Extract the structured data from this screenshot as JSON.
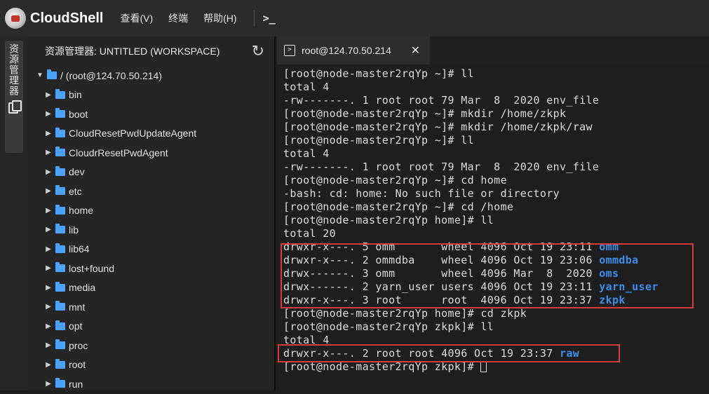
{
  "app": {
    "brand": "CloudShell"
  },
  "menu": [
    "查看(V)",
    "终端",
    "帮助(H)"
  ],
  "toolbar": {
    "terminal_icon": ">_"
  },
  "activity": {
    "explorer_label": "资源管理器"
  },
  "explorer": {
    "title": "资源管理器: UNTITLED (WORKSPACE)",
    "root": "/ (root@124.70.50.214)",
    "items": [
      "bin",
      "boot",
      "CloudResetPwdUpdateAgent",
      "CloudrResetPwdAgent",
      "dev",
      "etc",
      "home",
      "lib",
      "lib64",
      "lost+found",
      "media",
      "mnt",
      "opt",
      "proc",
      "root",
      "run"
    ]
  },
  "tab": {
    "label": "root@124.70.50.214"
  },
  "colors": {
    "accent": "#3b8eea",
    "highlight": "#d83b3b",
    "folder": "#4aa3ff"
  },
  "terminal_lines": [
    [
      {
        "t": "[root@node-master2rqYp ~]# ll"
      }
    ],
    [
      {
        "t": "total 4"
      }
    ],
    [
      {
        "t": "-rw-------. 1 root root 79 Mar  8  2020 env_file"
      }
    ],
    [
      {
        "t": "[root@node-master2rqYp ~]# mkdir /home/zkpk"
      }
    ],
    [
      {
        "t": "[root@node-master2rqYp ~]# mkdir /home/zkpk/raw"
      }
    ],
    [
      {
        "t": "[root@node-master2rqYp ~]# ll"
      }
    ],
    [
      {
        "t": "total 4"
      }
    ],
    [
      {
        "t": "-rw-------. 1 root root 79 Mar  8  2020 env_file"
      }
    ],
    [
      {
        "t": "[root@node-master2rqYp ~]# cd home"
      }
    ],
    [
      {
        "t": "-bash: cd: home: No such file or directory"
      }
    ],
    [
      {
        "t": "[root@node-master2rqYp ~]# cd /home"
      }
    ],
    [
      {
        "t": "[root@node-master2rqYp home]# ll"
      }
    ],
    [
      {
        "t": "total 20"
      }
    ],
    [
      {
        "t": "drwxr-x---. 5 omm       wheel 4096 Oct 19 23:11 "
      },
      {
        "t": "omm",
        "dir": true
      }
    ],
    [
      {
        "t": "drwxr-x---. 2 ommdba    wheel 4096 Oct 19 23:06 "
      },
      {
        "t": "ommdba",
        "dir": true
      }
    ],
    [
      {
        "t": "drwx------. 3 omm       wheel 4096 Mar  8  2020 "
      },
      {
        "t": "oms",
        "dir": true
      }
    ],
    [
      {
        "t": "drwx------. 2 yarn_user users 4096 Oct 19 23:11 "
      },
      {
        "t": "yarn_user",
        "dir": true
      }
    ],
    [
      {
        "t": "drwxr-x---. 3 root      root  4096 Oct 19 23:37 "
      },
      {
        "t": "zkpk",
        "dir": true
      }
    ],
    [
      {
        "t": "[root@node-master2rqYp home]# cd zkpk"
      }
    ],
    [
      {
        "t": "[root@node-master2rqYp zkpk]# ll"
      }
    ],
    [
      {
        "t": "total 4"
      }
    ],
    [
      {
        "t": "drwxr-x---. 2 root root 4096 Oct 19 23:37 "
      },
      {
        "t": "raw",
        "dir": true
      }
    ],
    [
      {
        "t": "[root@node-master2rqYp zkpk]# "
      }
    ]
  ]
}
